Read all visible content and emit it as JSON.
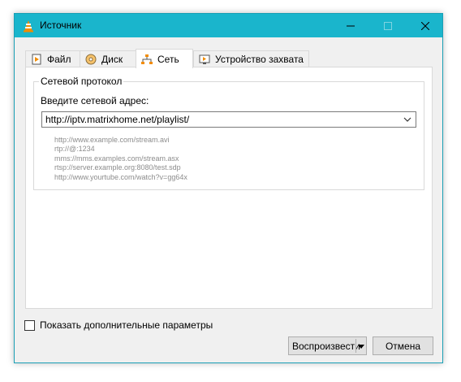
{
  "window": {
    "title": "Источник"
  },
  "tabs": [
    {
      "label": "Файл",
      "icon": "file-icon"
    },
    {
      "label": "Диск",
      "icon": "disc-icon"
    },
    {
      "label": "Сеть",
      "icon": "network-icon",
      "active": true
    },
    {
      "label": "Устройство захвата",
      "icon": "capture-device-icon"
    }
  ],
  "network": {
    "group_title": "Сетевой протокол",
    "address_label": "Введите сетевой адрес:",
    "address_value": "http://iptv.matrixhome.net/playlist/",
    "examples": [
      "http://www.example.com/stream.avi",
      "rtp://@:1234",
      "mms://mms.examples.com/stream.asx",
      "rtsp://server.example.org:8080/test.sdp",
      "http://www.yourtube.com/watch?v=gg64x"
    ]
  },
  "options": {
    "show_more_label": "Показать дополнительные параметры",
    "checked": false
  },
  "buttons": {
    "play_label": "Воспроизвести",
    "cancel_label": "Отмена"
  },
  "colors": {
    "titlebar": "#1ab5cc",
    "accent_orange": "#f28c00"
  }
}
